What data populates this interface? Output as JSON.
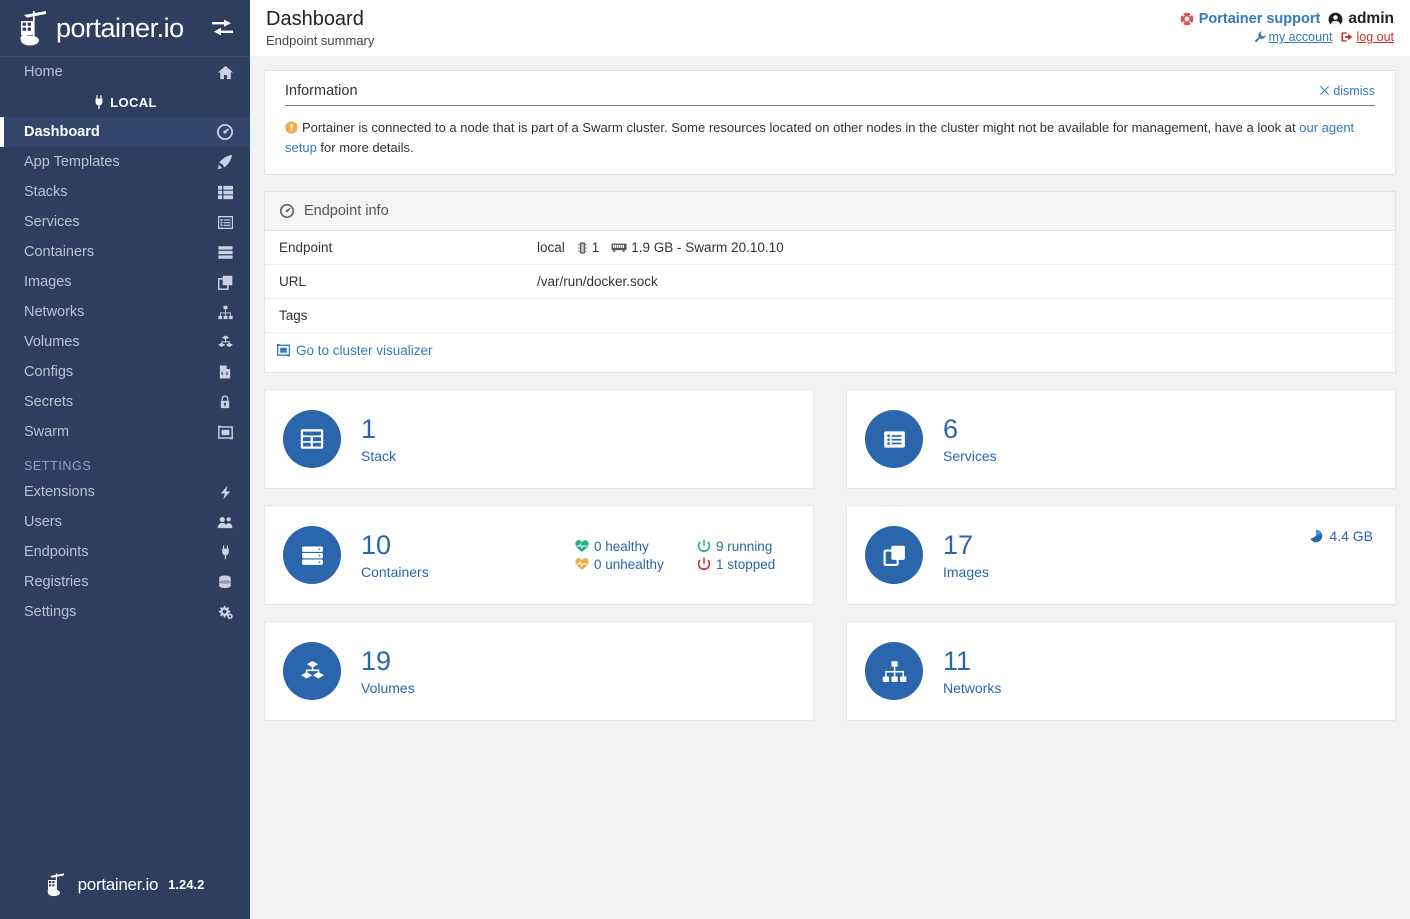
{
  "sidebar": {
    "brand": {
      "name": "portainer.io",
      "toggle_icon": "exchange-arrows-icon"
    },
    "home": {
      "label": "Home",
      "icon": "home-icon"
    },
    "local_label": "LOCAL",
    "items": [
      {
        "label": "Dashboard",
        "icon": "dashboard-gauge-icon",
        "active": true
      },
      {
        "label": "App Templates",
        "icon": "rocket-icon",
        "active": false
      },
      {
        "label": "Stacks",
        "icon": "stack-list-icon",
        "active": false
      },
      {
        "label": "Services",
        "icon": "services-list-icon",
        "active": false
      },
      {
        "label": "Containers",
        "icon": "containers-server-icon",
        "active": false
      },
      {
        "label": "Images",
        "icon": "images-clone-icon",
        "active": false
      },
      {
        "label": "Networks",
        "icon": "networks-sitemap-icon",
        "active": false
      },
      {
        "label": "Volumes",
        "icon": "volumes-cubes-icon",
        "active": false
      },
      {
        "label": "Configs",
        "icon": "configs-file-code-icon",
        "active": false
      },
      {
        "label": "Secrets",
        "icon": "secrets-lock-icon",
        "active": false
      },
      {
        "label": "Swarm",
        "icon": "swarm-icon",
        "active": false
      }
    ],
    "settings_section": "SETTINGS",
    "settings_items": [
      {
        "label": "Extensions",
        "icon": "bolt-icon"
      },
      {
        "label": "Users",
        "icon": "users-icon"
      },
      {
        "label": "Endpoints",
        "icon": "plug-icon"
      },
      {
        "label": "Registries",
        "icon": "database-icon"
      },
      {
        "label": "Settings",
        "icon": "cogs-icon"
      }
    ],
    "footer": {
      "name": "portainer.io",
      "version": "1.24.2"
    }
  },
  "header": {
    "title": "Dashboard",
    "subtitle": "Endpoint summary",
    "support_label": "Portainer support",
    "support_icon": "life-ring-icon",
    "user_label": "admin",
    "user_icon": "user-circle-icon",
    "my_account_label": "my account",
    "my_account_icon": "wrench-icon",
    "logout_label": "log out",
    "logout_icon": "sign-out-icon"
  },
  "information": {
    "title": "Information",
    "dismiss_label": "dismiss",
    "dismiss_icon": "close-x-icon",
    "warn_icon": "exclamation-circle-icon",
    "text_part1": "Portainer is connected to a node that is part of a Swarm cluster. Some resources located on other nodes in the cluster might not be available for management, have a look at ",
    "link_text": "our agent setup",
    "text_part2": " for more details."
  },
  "endpoint_info": {
    "panel_title": "Endpoint info",
    "panel_icon": "gauge-icon",
    "rows": [
      {
        "key": "Endpoint",
        "value": "local"
      },
      {
        "key": "URL",
        "value": "/var/run/docker.sock"
      },
      {
        "key": "Tags",
        "value": ""
      }
    ],
    "cpu_icon": "cpu-chip-icon",
    "cpu_value": "1",
    "memory_icon": "memory-stick-icon",
    "memory_value": "1.9 GB - Swarm 20.10.10",
    "cluster_link_label": "Go to cluster visualizer",
    "cluster_link_icon": "cluster-visualizer-icon"
  },
  "cards": {
    "stack": {
      "count": "1",
      "label": "Stack",
      "icon": "stack-table-icon"
    },
    "services": {
      "count": "6",
      "label": "Services",
      "icon": "services-list-icon"
    },
    "containers": {
      "count": "10",
      "label": "Containers",
      "icon": "containers-server-icon",
      "healthy": "0 healthy",
      "healthy_icon": "heartbeat-green-icon",
      "unhealthy": "0 unhealthy",
      "unhealthy_icon": "heartbeat-orange-icon",
      "running": "9 running",
      "running_icon": "power-green-icon",
      "stopped": "1 stopped",
      "stopped_icon": "power-red-icon"
    },
    "images": {
      "count": "17",
      "label": "Images",
      "icon": "images-clone-icon",
      "size": "4.4 GB",
      "size_icon": "pie-chart-icon"
    },
    "volumes": {
      "count": "19",
      "label": "Volumes",
      "icon": "volumes-cubes-icon"
    },
    "networks": {
      "count": "11",
      "label": "Networks",
      "icon": "networks-sitemap-icon"
    }
  },
  "colors": {
    "sidebar_bg": "#2d3e5e",
    "accent_blue": "#2b65ac",
    "link_blue": "#337ab7",
    "danger_red": "#c9302c",
    "warn_orange": "#f0ad4e",
    "success_green": "#23ae89"
  }
}
